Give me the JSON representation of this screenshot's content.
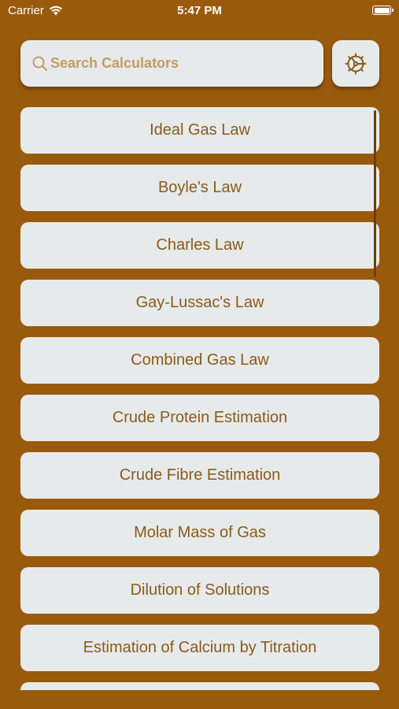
{
  "status_bar": {
    "carrier": "Carrier",
    "time": "5:47 PM"
  },
  "search": {
    "placeholder": "Search Calculators",
    "value": ""
  },
  "settings_icon": "gear-icon",
  "calculators": [
    {
      "label": "Ideal Gas Law"
    },
    {
      "label": "Boyle's Law"
    },
    {
      "label": "Charles Law"
    },
    {
      "label": "Gay-Lussac's Law"
    },
    {
      "label": "Combined Gas Law"
    },
    {
      "label": "Crude Protein Estimation"
    },
    {
      "label": "Crude Fibre Estimation"
    },
    {
      "label": "Molar Mass of Gas"
    },
    {
      "label": "Dilution of Solutions"
    },
    {
      "label": "Estimation of Calcium by Titration"
    },
    {
      "label": ""
    }
  ],
  "colors": {
    "background": "#9a5a0c",
    "card": "#e7eaeb",
    "text": "#8a5a1a"
  }
}
